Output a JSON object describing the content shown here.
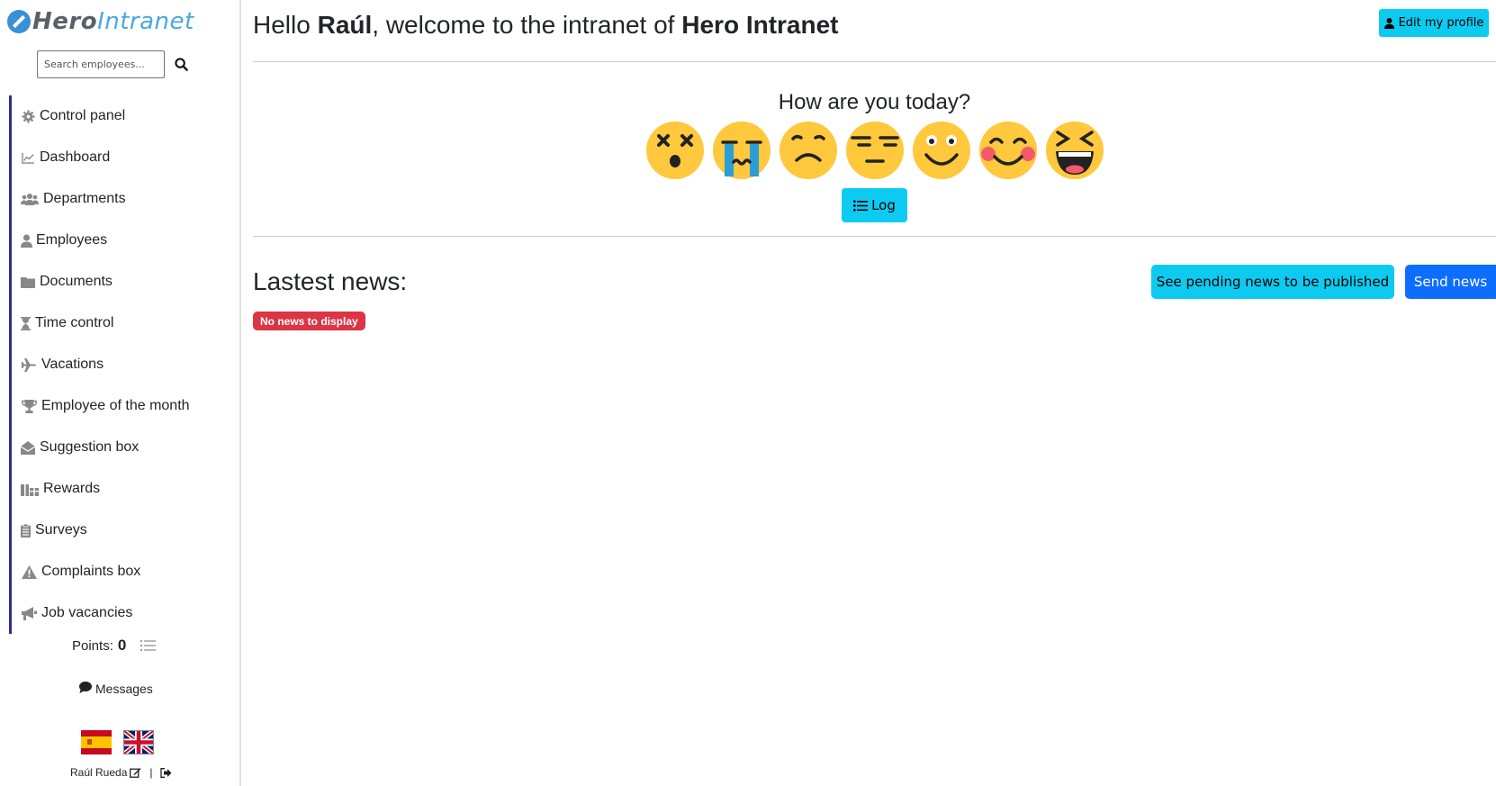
{
  "brand": {
    "part1": "Hero",
    "part2": "Intranet"
  },
  "search": {
    "placeholder": "Search employees..."
  },
  "sidebar": {
    "items": [
      {
        "label": "Control panel",
        "icon": "gear-icon"
      },
      {
        "label": "Dashboard",
        "icon": "chart-line-icon"
      },
      {
        "label": "Departments",
        "icon": "users-icon"
      },
      {
        "label": "Employees",
        "icon": "user-icon"
      },
      {
        "label": "Documents",
        "icon": "folder-icon"
      },
      {
        "label": "Time control",
        "icon": "hourglass-icon"
      },
      {
        "label": "Vacations",
        "icon": "plane-icon"
      },
      {
        "label": "Employee of the month",
        "icon": "trophy-icon"
      },
      {
        "label": "Suggestion box",
        "icon": "envelope-open-icon"
      },
      {
        "label": "Rewards",
        "icon": "gifts-icon"
      },
      {
        "label": "Surveys",
        "icon": "clipboard-icon"
      },
      {
        "label": "Complaints box",
        "icon": "warning-icon"
      },
      {
        "label": "Job vacancies",
        "icon": "bullhorn-icon"
      }
    ],
    "points_label": "Points:",
    "points_value": "0",
    "messages_label": "Messages",
    "user_name": "Raúl Rueda",
    "separator": "|"
  },
  "header": {
    "greeting_prefix": "Hello ",
    "user": "Raúl",
    "greeting_middle": ", welcome to the intranet of ",
    "company": "Hero Intranet",
    "edit_profile_label": "Edit my profile"
  },
  "mood": {
    "question": "How are you today?",
    "options": [
      "dizzy-face",
      "crying-face",
      "sad-face",
      "expressionless-face",
      "smiling-face",
      "blushing-face",
      "laughing-face"
    ],
    "log_label": "Log"
  },
  "news": {
    "title": "Lastest news:",
    "pending_label": "See pending news to be published",
    "send_label": "Send news",
    "empty_label": "No news to display"
  },
  "colors": {
    "info": "#0dcaf0",
    "primary": "#0d6efd",
    "danger": "#dc3545",
    "sidebar_accent": "#2a2f8c",
    "emoji_yellow": "#ffc83d"
  }
}
